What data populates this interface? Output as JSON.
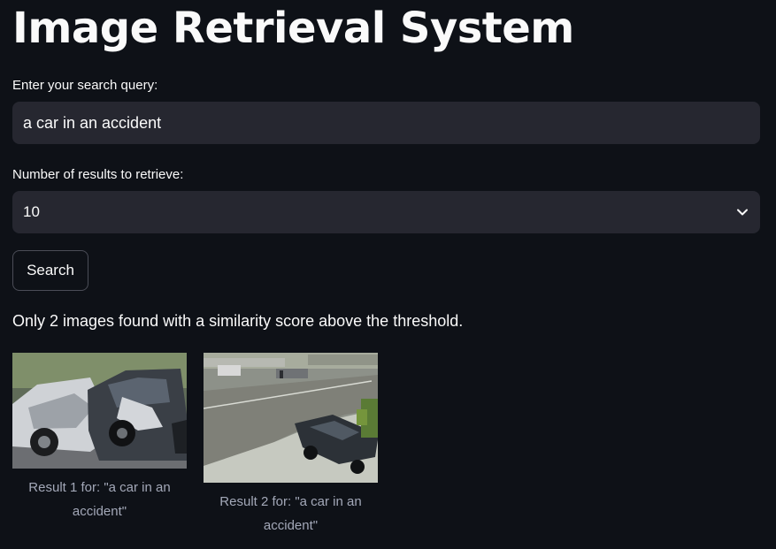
{
  "app": {
    "title": "Image Retrieval System"
  },
  "form": {
    "query_label": "Enter your search query:",
    "query_value": "a car in an accident",
    "count_label": "Number of results to retrieve:",
    "count_value": "10",
    "search_button": "Search"
  },
  "status": "Only 2 images found with a similarity score above the threshold.",
  "results": [
    {
      "caption": "Result 1 for: \"a car in an accident\""
    },
    {
      "caption": "Result 2 for: \"a car in an accident\""
    }
  ],
  "colors": {
    "background": "#0e1117",
    "input_bg": "#262730",
    "text": "#fafafa",
    "caption": "#a3a8b8"
  }
}
